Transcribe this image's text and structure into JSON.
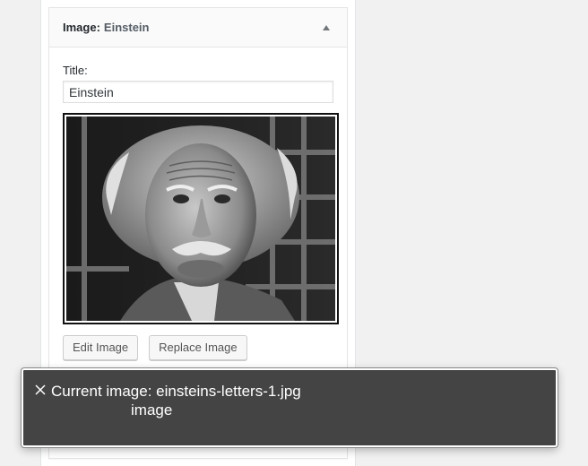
{
  "widget": {
    "header_prefix": "Image:",
    "header_title": "Einstein",
    "title_label": "Title:",
    "title_value": "Einstein",
    "image_alt": "Einstein",
    "edit_button": "Edit Image",
    "replace_button": "Replace Image"
  },
  "tooltip": {
    "line1": "Current image: einsteins-letters-1.jpg",
    "line2": "image",
    "close_icon": "close-icon"
  },
  "colors": {
    "page_background": "#f1f1f1",
    "tooltip_background": "#444444",
    "button_background": "#f7f7f7"
  }
}
